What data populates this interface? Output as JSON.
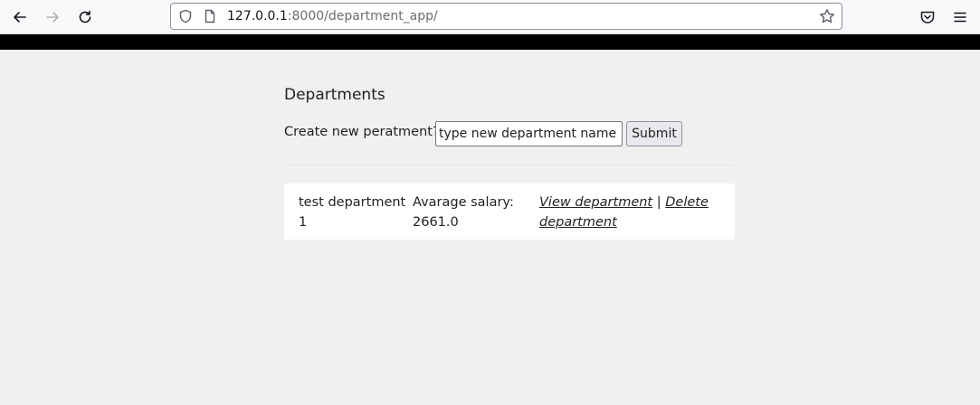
{
  "browser": {
    "url_host": "127.0.0.1",
    "url_path": ":8000/department_app/"
  },
  "page": {
    "title": "Departments",
    "create_label": "Create new peratment?",
    "input_placeholder": "type new department name",
    "submit_label": "Submit"
  },
  "departments": [
    {
      "name": "test department 1",
      "salary_label": "Avarage salary:",
      "salary_value": "2661.0",
      "view_link": "View department",
      "separator": "|",
      "delete_link": "Delete department"
    }
  ]
}
